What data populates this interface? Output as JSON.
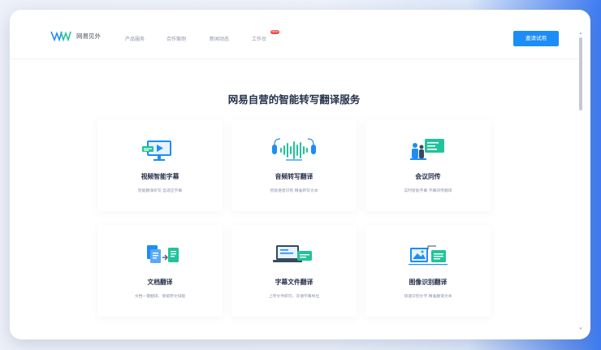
{
  "brand": {
    "logo_text": "网易见外"
  },
  "nav": {
    "items": [
      "产品服务",
      "合作案例",
      "新闻动态",
      "工作台"
    ],
    "badge": "NEW",
    "cta_label": "邀请试用"
  },
  "section": {
    "heading": "网易自营的智能转写翻译服务"
  },
  "services": [
    {
      "title": "视频智能字幕",
      "desc": "智能翻译听写 自适应字幕"
    },
    {
      "title": "音频转写翻译",
      "desc": "智能语音识别 精准转写文本"
    },
    {
      "title": "会议同传",
      "desc": "实时智能字幕 字幕同传翻译"
    },
    {
      "title": "文档翻译",
      "desc": "文档一键翻译，保留原文排版"
    },
    {
      "title": "字幕文件翻译",
      "desc": "上传文件即可，双语字幕导出"
    },
    {
      "title": "图像识别翻译",
      "desc": "快速识别文字 精准翻译文本"
    }
  ],
  "colors": {
    "accent": "#1c8df6",
    "green": "#22c39a",
    "heading": "#24324a",
    "badge": "#ef4444"
  },
  "icons": [
    "video-monitor-icon",
    "audio-wave-icon",
    "meeting-icon",
    "document-icon",
    "subtitle-laptop-icon",
    "image-recognition-icon"
  ]
}
